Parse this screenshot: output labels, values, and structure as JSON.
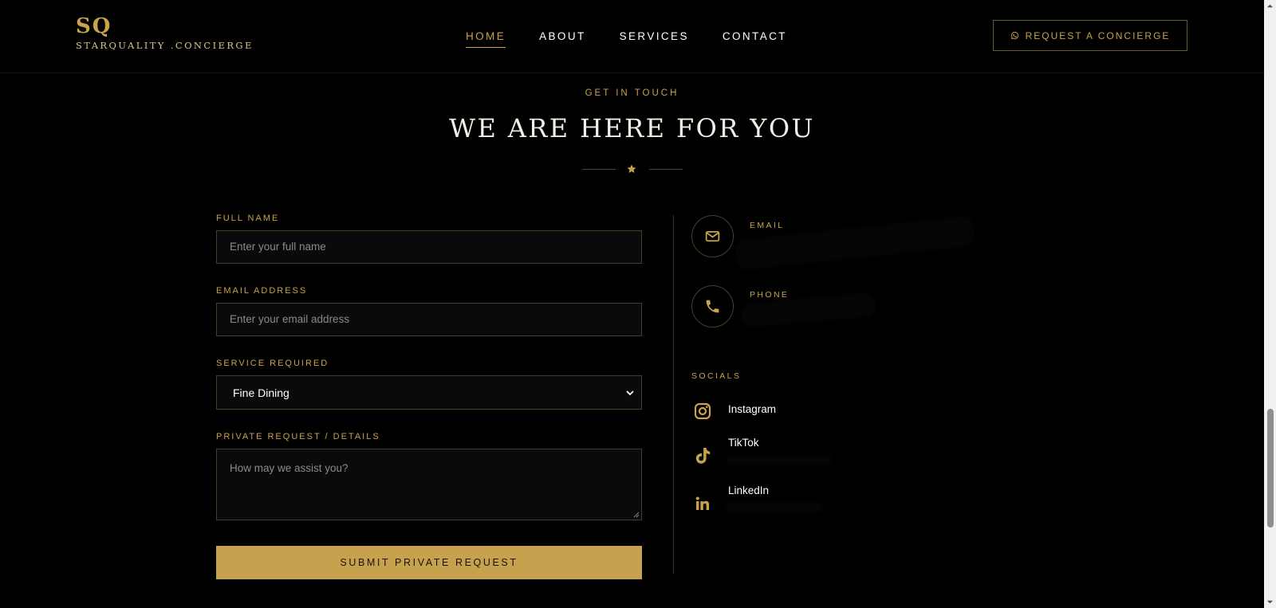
{
  "header": {
    "logo_mark": "SQ",
    "logo_text": "STARQUALITY .CONCIERGE",
    "nav": [
      {
        "label": "HOME",
        "active": true
      },
      {
        "label": "ABOUT",
        "active": false
      },
      {
        "label": "SERVICES",
        "active": false
      },
      {
        "label": "CONTACT",
        "active": false
      }
    ],
    "cta_label": "REQUEST A CONCIERGE",
    "cta_icon": "whatsapp-icon"
  },
  "section": {
    "eyebrow": "GET IN TOUCH",
    "title": "WE ARE HERE FOR YOU",
    "divider_icon": "star-icon"
  },
  "form": {
    "full_name_label": "FULL NAME",
    "full_name_placeholder": "Enter your full name",
    "email_label": "EMAIL ADDRESS",
    "email_placeholder": "Enter your email address",
    "service_label": "SERVICE REQUIRED",
    "service_value": "Fine Dining",
    "details_label": "PRIVATE REQUEST / DETAILS",
    "details_placeholder": "How may we assist you?",
    "submit_label": "SUBMIT PRIVATE REQUEST"
  },
  "contact": {
    "email_label": "EMAIL",
    "phone_label": "PHONE",
    "socials_label": "SOCIALS",
    "socials": [
      {
        "name": "Instagram",
        "icon": "instagram-icon"
      },
      {
        "name": "TikTok",
        "icon": "tiktok-icon"
      },
      {
        "name": "LinkedIn",
        "icon": "linkedin-icon"
      }
    ]
  },
  "colors": {
    "accent": "#c9a24a",
    "background": "#000000",
    "button": "#c6a14e"
  }
}
